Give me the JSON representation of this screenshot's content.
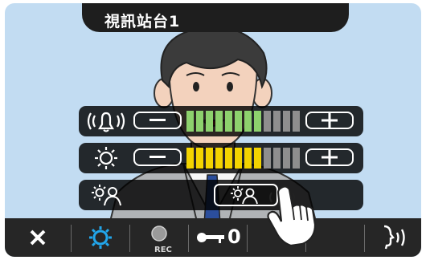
{
  "window": {
    "title": "視訊站台1"
  },
  "controls": {
    "volume": {
      "icon": "bell-ring-icon",
      "level": 8,
      "segments": 12,
      "active_color": "#8dd16d",
      "inactive_color": "#8e8e8e"
    },
    "brightness": {
      "icon": "sun-icon",
      "level": 8,
      "segments": 12,
      "active_color": "#f3d400",
      "inactive_color": "#8e8e8e"
    },
    "backlight": {
      "icon": "sun-person-icon",
      "button_icon": "sun-person-icon"
    }
  },
  "toolbar": {
    "items": [
      {
        "icon": "close-icon"
      },
      {
        "icon": "gear-icon",
        "color": "#22a7ec"
      },
      {
        "icon": "record-icon",
        "label": "REC"
      },
      {
        "icon": "key-icon",
        "label": "0"
      },
      {
        "icon": "blank"
      },
      {
        "icon": "blank"
      },
      {
        "icon": "talk-icon"
      }
    ]
  }
}
